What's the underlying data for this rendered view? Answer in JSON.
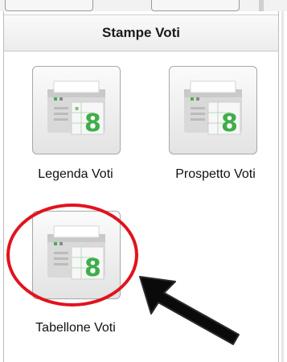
{
  "panel": {
    "title": "Stampe Voti"
  },
  "tiles": [
    {
      "label": "Legenda Voti",
      "icon": "printer-grade-icon"
    },
    {
      "label": "Prospetto Voti",
      "icon": "printer-grade-icon"
    },
    {
      "label": "Tabellone Voti",
      "icon": "printer-grade-icon",
      "highlighted": true
    }
  ],
  "annotations": {
    "highlight_color": "#e0141e",
    "arrow_color": "#0a0a0a",
    "highlight_target": "Tabellone Voti"
  }
}
